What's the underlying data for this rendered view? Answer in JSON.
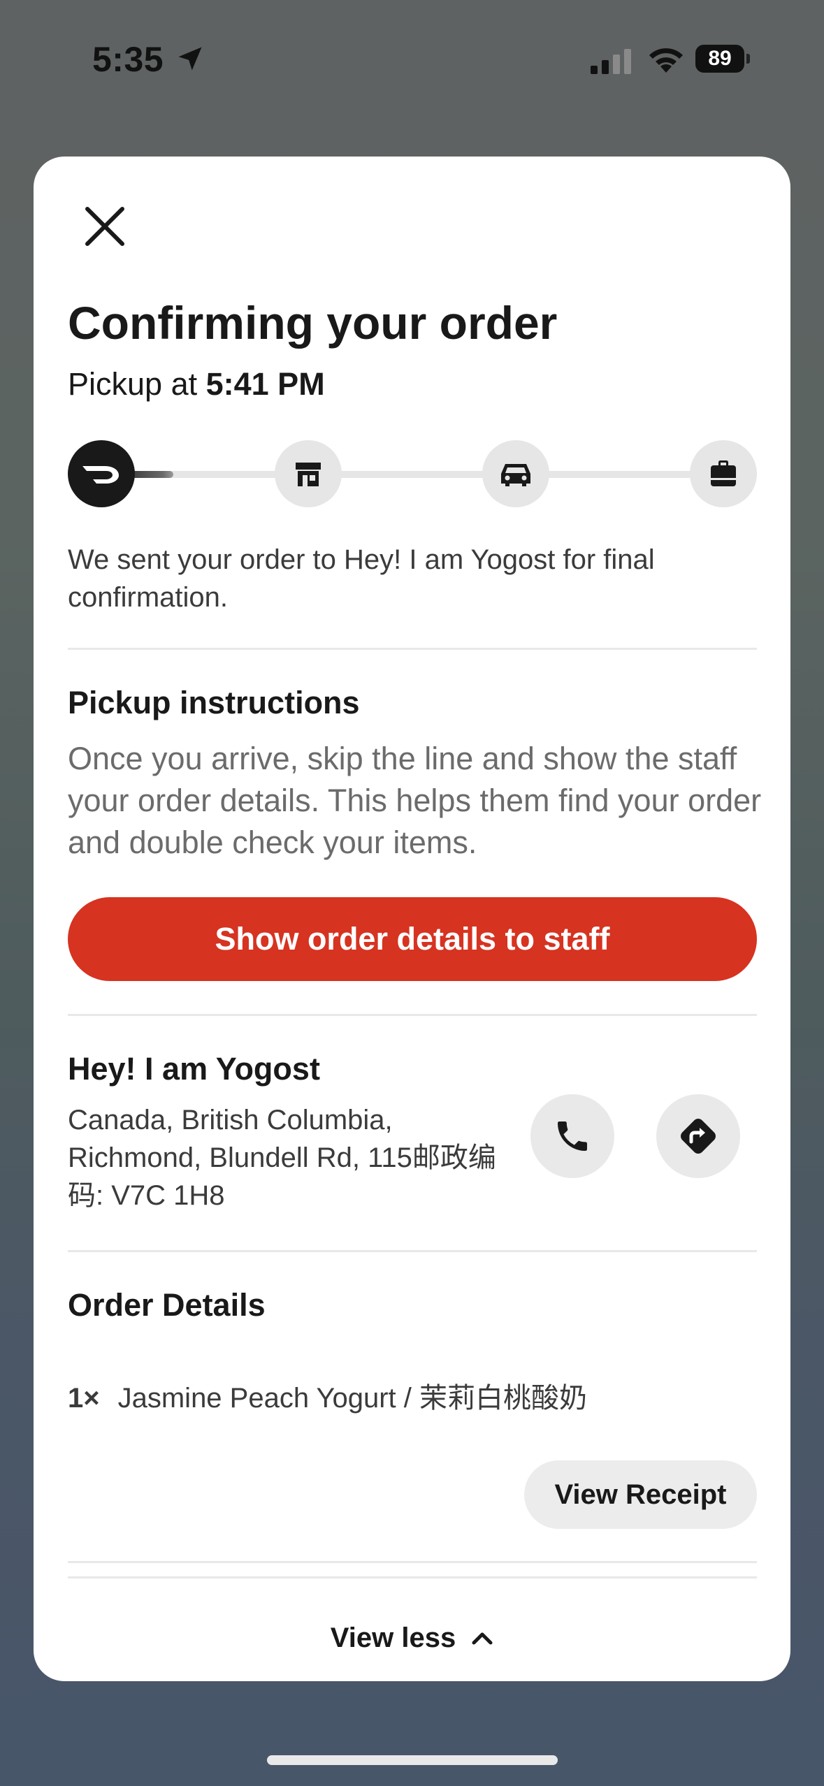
{
  "status_bar": {
    "time": "5:35",
    "battery": "89"
  },
  "sheet": {
    "title": "Confirming your order",
    "pickup_prefix": "Pickup at ",
    "pickup_time": "5:41 PM",
    "progress": {
      "steps": [
        "doordash-logo-icon",
        "store-icon",
        "car-icon",
        "bag-icon"
      ],
      "current_step": 1,
      "fill_fraction": 0.06
    },
    "sent_message": "We sent your order to Hey! I am Yogost for final confirmation.",
    "pickup_instructions": {
      "title": "Pickup instructions",
      "body": "Once you arrive, skip the line and show the staff your order details. This helps them find your order and double check your items.",
      "button_label": "Show order details to staff"
    },
    "store": {
      "name": "Hey! I am Yogost",
      "address": "Canada, British Columbia, Richmond, Blundell Rd, 115邮政编码: V7C 1H8"
    },
    "order_details": {
      "title": "Order Details",
      "items": [
        {
          "qty": "1×",
          "name": "Jasmine Peach Yogurt / 茉莉白桃酸奶"
        }
      ],
      "receipt_label": "View Receipt"
    },
    "view_less_label": "View less"
  },
  "colors": {
    "accent_red": "#d63321",
    "dark": "#191919",
    "muted_text": "#6b6b6b"
  }
}
